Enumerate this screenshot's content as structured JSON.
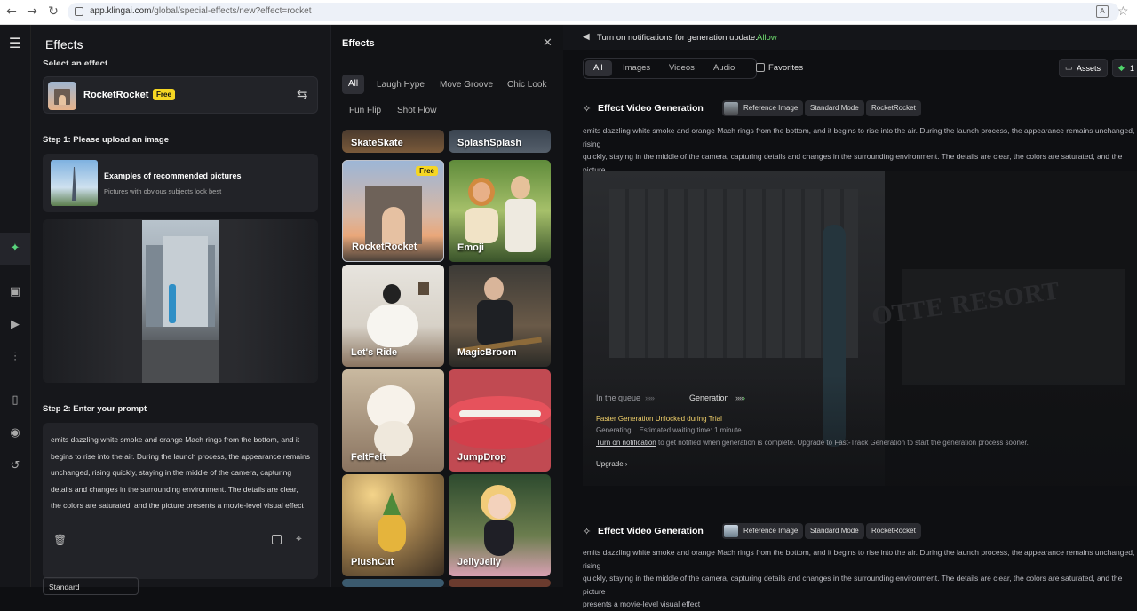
{
  "browser": {
    "url_host": "app.klingai.com",
    "url_path": "/global/special-effects/new?effect=rocket"
  },
  "left": {
    "title": "Effects",
    "select_label": "Select an effect",
    "selected_effect": {
      "name": "RocketRocket",
      "badge": "Free"
    },
    "step1": "Step 1: Please upload an image",
    "examples_title": "Examples of recommended pictures",
    "examples_sub": "Pictures with obvious subjects look best",
    "step2": "Step 2: Enter your prompt",
    "prompt": "emits dazzling white smoke and orange Mach rings from the bottom, and it begins to rise into the air. During the launch process, the appearance remains unchanged, rising quickly, staying in the middle of the camera, capturing details and changes in the surrounding environment. The details are clear, the colors are saturated, and the picture presents a movie-level visual effect",
    "mode": "Standard"
  },
  "effects": {
    "title": "Effects",
    "tabs": [
      "All",
      "Laugh Hype",
      "Move Groove",
      "Chic Look",
      "Fun Flip",
      "Shot Flow"
    ],
    "top_partial": [
      "SkateSkate",
      "SplashSplash"
    ],
    "tiles": [
      {
        "name": "RocketRocket",
        "badge": "Free"
      },
      {
        "name": "Emoji"
      },
      {
        "name": "Let's Ride"
      },
      {
        "name": "MagicBroom"
      },
      {
        "name": "FeltFelt"
      },
      {
        "name": "JumpDrop"
      },
      {
        "name": "PlushCut"
      },
      {
        "name": "JellyJelly"
      }
    ]
  },
  "right": {
    "notice": "Turn on notifications for generation update.",
    "allow": "Allow",
    "filters": [
      "All",
      "Images",
      "Videos",
      "Audio"
    ],
    "favorites": "Favorites",
    "assets": "Assets",
    "credits": "1",
    "gen_title": "Effect Video Generation",
    "chips": [
      "Reference Image",
      "Standard Mode",
      "RocketRocket"
    ],
    "prompt1": "emits dazzling white smoke and orange Mach rings from the bottom, and it begins to rise into the air. During the launch process, the appearance remains unchanged, rising",
    "prompt2": "quickly, staying in the middle of the camera, capturing details and changes in the surrounding environment. The details are clear, the colors are saturated, and the picture",
    "prompt3": "presents a movie-level visual effect",
    "queue_label": "In the queue",
    "gen_label": "Generation",
    "faster": "Faster Generation Unlocked during Trial",
    "generating": "Generating... Estimated waiting time: 1 minute",
    "notif_link": "Turn on notification",
    "notif_rest": " to get notified when generation is complete. Upgrade to Fast-Track Generation to start the generation process sooner.",
    "upgrade": "Upgrade",
    "watermark": "OTTE RESORT"
  }
}
